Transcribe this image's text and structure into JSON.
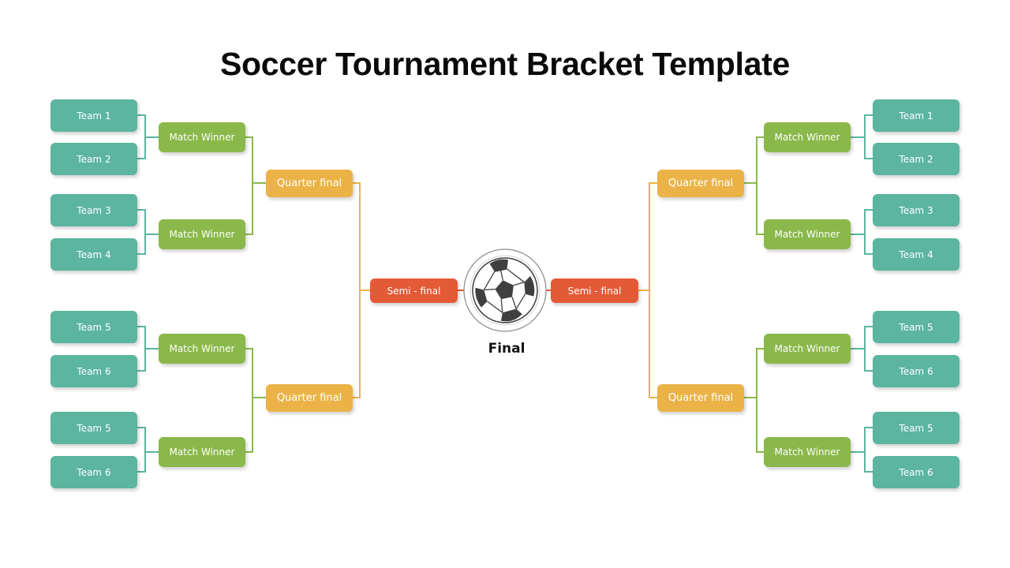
{
  "title": "Soccer Tournament Bracket Template",
  "colors": {
    "team": "#5bb59f",
    "match_winner": "#8ab84a",
    "quarter_final": "#ebb347",
    "semi_final": "#e55a36",
    "team_line": "#5bb59f",
    "mw_line": "#8ab84a",
    "qf_line": "#ebb347",
    "semi_line": "#e55a36"
  },
  "left": {
    "teams": [
      "Team 1",
      "Team 2",
      "Team 3",
      "Team 4",
      "Team 5",
      "Team 6",
      "Team 5",
      "Team 6"
    ],
    "match_winners": [
      "Match Winner",
      "Match Winner",
      "Match Winner",
      "Match Winner"
    ],
    "quarter_finals": [
      "Quarter final",
      "Quarter final"
    ],
    "semi_final": "Semi - final"
  },
  "right": {
    "teams": [
      "Team 1",
      "Team 2",
      "Team 3",
      "Team 4",
      "Team 5",
      "Team 6",
      "Team 5",
      "Team 6"
    ],
    "match_winners": [
      "Match Winner",
      "Match Winner",
      "Match Winner",
      "Match Winner"
    ],
    "quarter_finals": [
      "Quarter final",
      "Quarter final"
    ],
    "semi_final": "Semi - final"
  },
  "final": {
    "label": "Final",
    "icon": "soccer-ball-icon"
  }
}
